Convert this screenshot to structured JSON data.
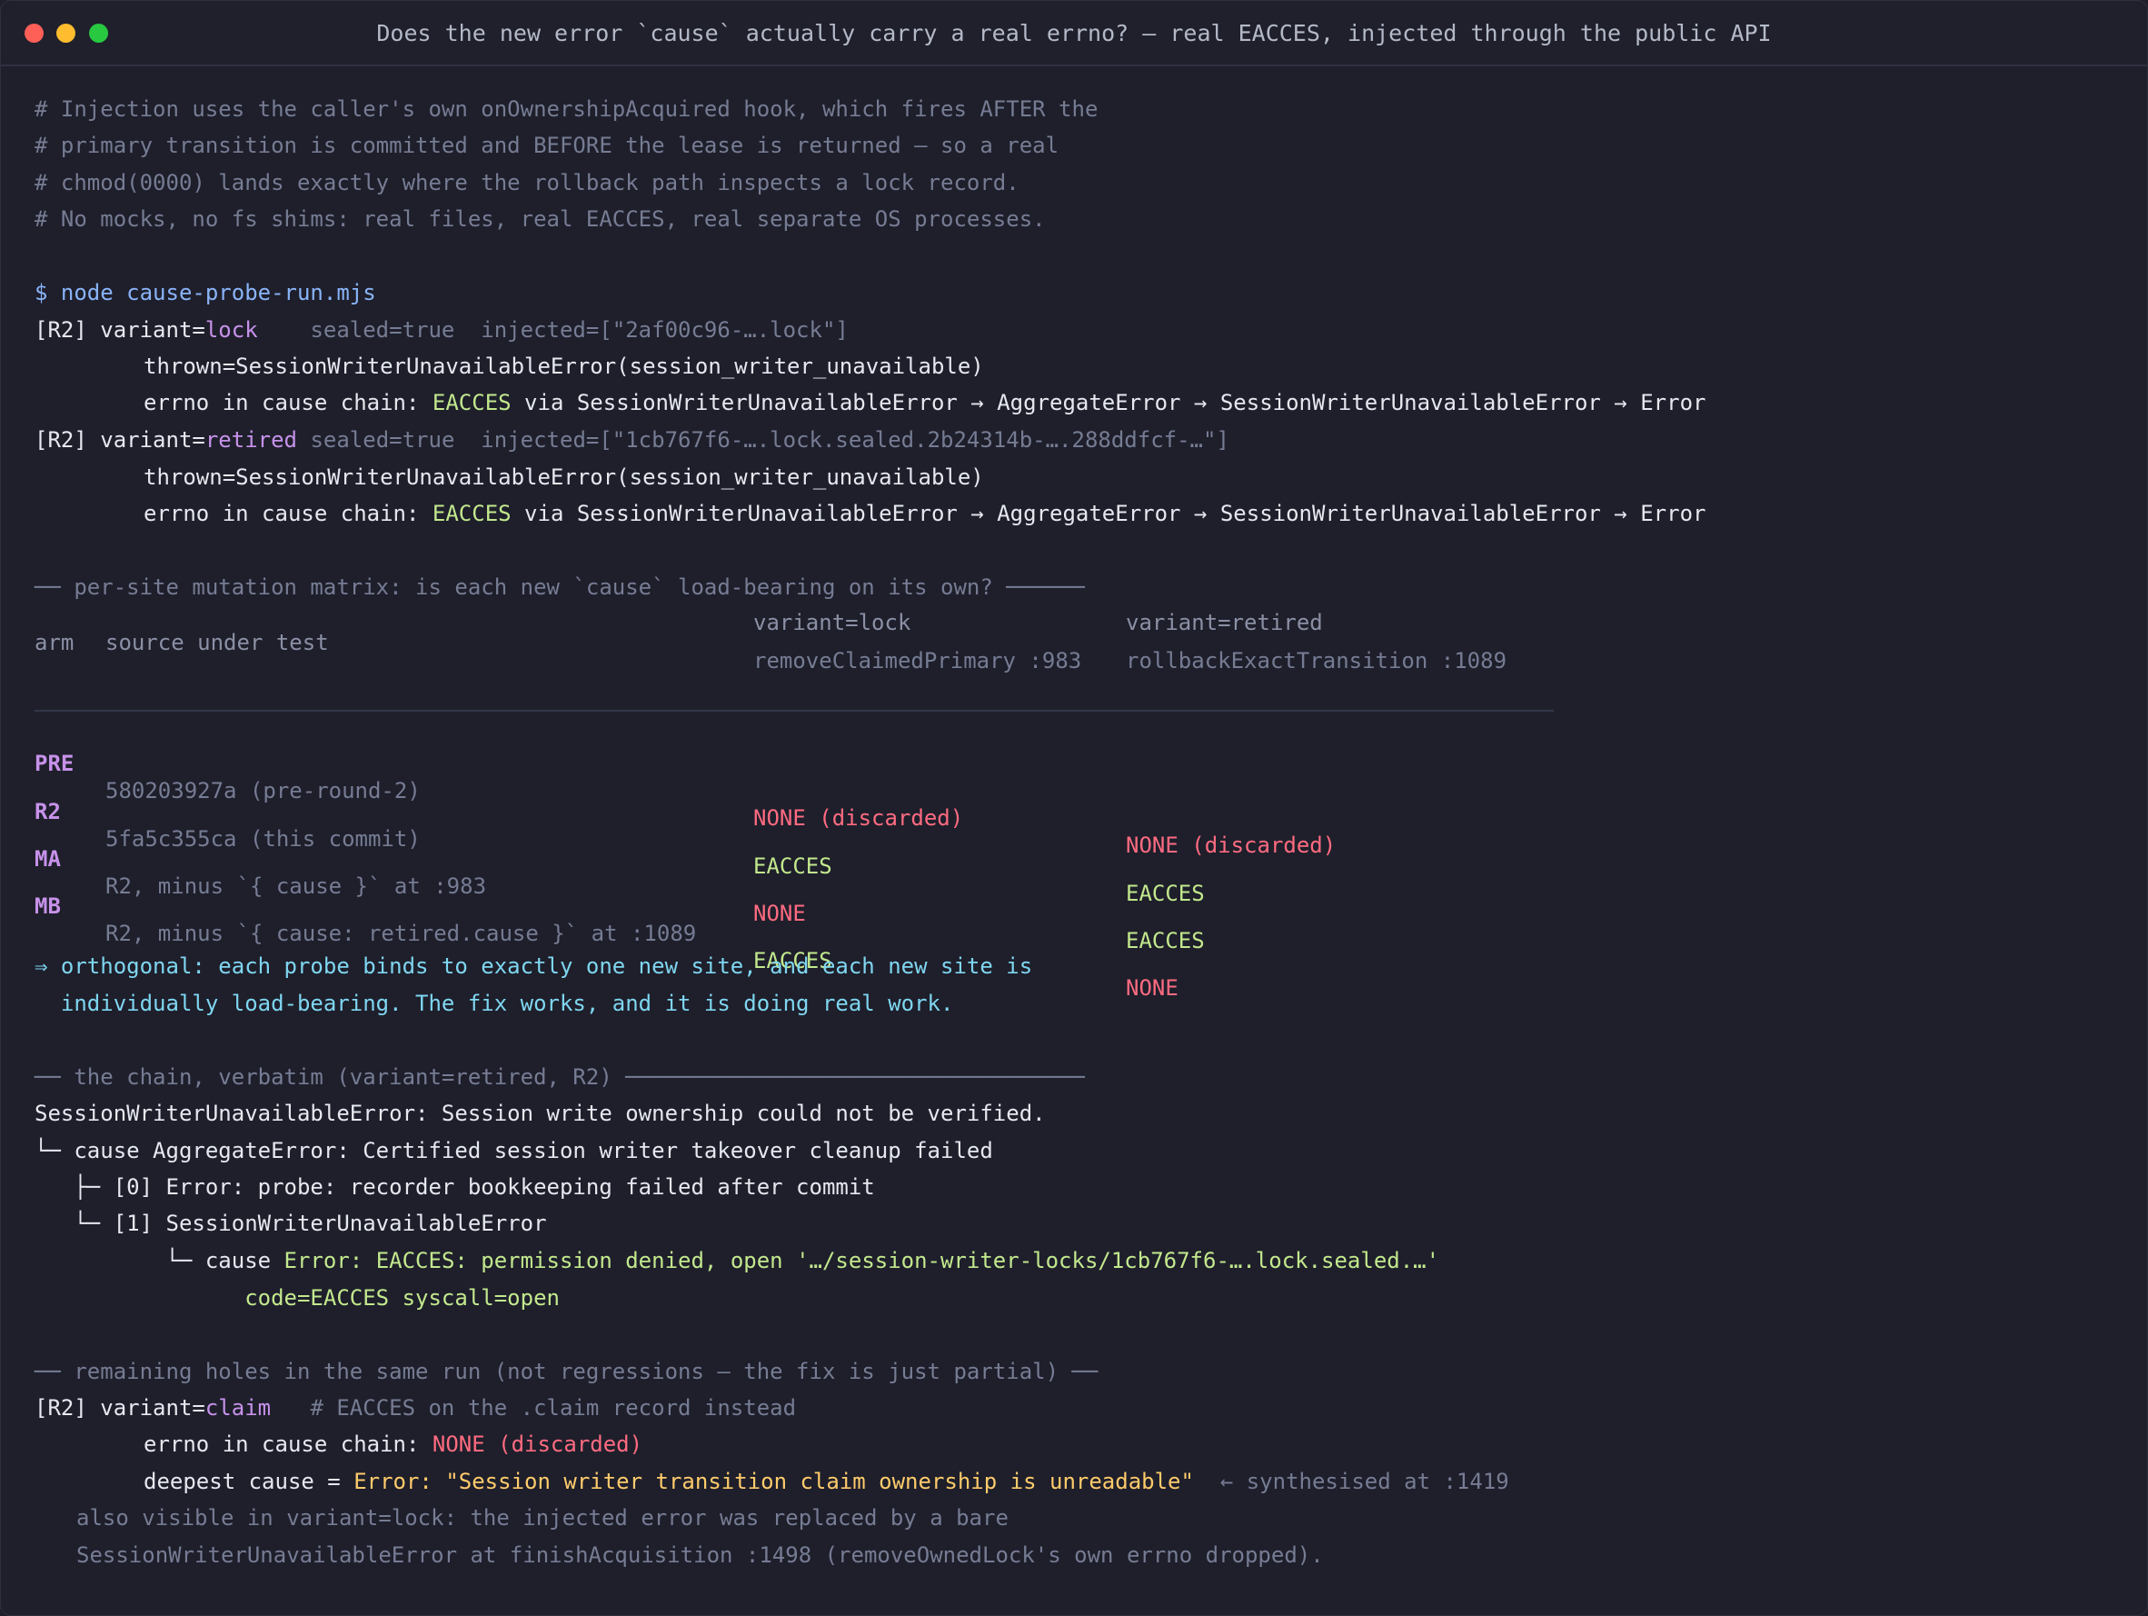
{
  "window": {
    "title": "Does the new error `cause` actually carry a real errno? — real EACCES, injected through the public API"
  },
  "comments": [
    "# Injection uses the caller's own onOwnershipAcquired hook, which fires AFTER the",
    "# primary transition is committed and BEFORE the lease is returned — so a real",
    "# chmod(0000) lands exactly where the rollback path inspects a lock record.",
    "# No mocks, no fs shims: real files, real EACCES, real separate OS processes."
  ],
  "command": "$ node cause-probe-run.mjs",
  "runs": {
    "lock": {
      "tag": "[R2]",
      "variant_key": " variant=",
      "variant": "lock",
      "pad": "    ",
      "meta": "sealed=true  injected=[\"2af00c96-….lock\"]",
      "thrown": "thrown=SessionWriterUnavailableError(session_writer_unavailable)",
      "errno_label": "errno in cause chain: ",
      "errno": "EACCES",
      "via": " via SessionWriterUnavailableError → AggregateError → SessionWriterUnavailableError → Error"
    },
    "retired": {
      "tag": "[R2]",
      "variant_key": " variant=",
      "variant": "retired",
      "pad": " ",
      "meta": "sealed=true  injected=[\"1cb767f6-….lock.sealed.2b24314b-….288ddfcf-…\"]",
      "thrown": "thrown=SessionWriterUnavailableError(session_writer_unavailable)",
      "errno_label": "errno in cause chain: ",
      "errno": "EACCES",
      "via": " via SessionWriterUnavailableError → AggregateError → SessionWriterUnavailableError → Error"
    }
  },
  "matrix": {
    "heading": "── per-site mutation matrix: is each new `cause` load-bearing on its own? ──────",
    "headers": {
      "arm": "arm",
      "source": "source under test",
      "lock": "variant=lock",
      "lock_site": "removeClaimedPrimary :983",
      "retired": "variant=retired",
      "retired_site": "rollbackExactTransition :1089"
    },
    "rows": [
      {
        "arm": "PRE",
        "source": "580203927a (pre-round-2)",
        "lock": "NONE (discarded)",
        "lock_status": "red",
        "retired": "NONE (discarded)",
        "retired_status": "red"
      },
      {
        "arm": "R2",
        "source": "5fa5c355ca (this commit)",
        "lock": "EACCES",
        "lock_status": "green",
        "retired": "EACCES",
        "retired_status": "green"
      },
      {
        "arm": "MA",
        "source": "R2, minus `{ cause }` at :983",
        "lock": "NONE",
        "lock_status": "red",
        "retired": "EACCES",
        "retired_status": "green"
      },
      {
        "arm": "MB",
        "source": "R2, minus `{ cause: retired.cause }` at :1089",
        "lock": "EACCES",
        "lock_status": "green",
        "retired": "NONE",
        "retired_status": "red"
      }
    ]
  },
  "conclusion": [
    "⇒ orthogonal: each probe binds to exactly one new site, and each new site is",
    "  individually load-bearing. The fix works, and it is doing real work."
  ],
  "chain": {
    "heading": "── the chain, verbatim (variant=retired, R2) ───────────────────────────────────",
    "root": "SessionWriterUnavailableError: Session write ownership could not be verified.",
    "cause_line": "└─ cause AggregateError: Certified session writer takeover cleanup failed",
    "item0": "   ├─ [0] Error: probe: recorder bookkeeping failed after commit",
    "item1": "   └─ [1] SessionWriterUnavailableError",
    "inner_prefix": "          └─ cause ",
    "inner_error": "Error: EACCES: permission denied, open '…/session-writer-locks/1cb767f6-….lock.sealed.…'",
    "code_line": "                code=EACCES syscall=open"
  },
  "holes": {
    "heading": "── remaining holes in the same run (not regressions — the fix is just partial) ──",
    "tag": "[R2]",
    "variant_key": " variant=",
    "variant": "claim",
    "comment": "   # EACCES on the .claim record instead",
    "errno_label": "errno in cause chain: ",
    "errno": "NONE (discarded)",
    "deepest_label": "deepest cause = ",
    "deepest_value": "Error: \"Session writer transition claim ownership is unreadable\"",
    "synth_note": "  ← synthesised at :1419",
    "note": [
      "also visible in variant=lock: the injected error was replaced by a bare",
      "SessionWriterUnavailableError at finishAcquisition :1498 (removeOwnedLock's own errno dropped)."
    ]
  },
  "colors": {
    "background": "#1e1f2b",
    "success": "#c3e88d",
    "failure": "#ff6b81",
    "accent": "#8ab4f8",
    "variant": "#c792ea",
    "conclusion": "#7fd6f0",
    "warning": "#ffcb6b"
  }
}
